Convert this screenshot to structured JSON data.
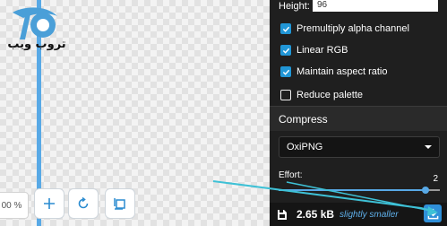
{
  "logo": {
    "text": "تروب ويب",
    "accent_color": "#4a9fd8"
  },
  "zoom": {
    "value": "00 %"
  },
  "controls": {
    "zoom_in_icon": "plus-icon",
    "rotate_icon": "rotate-icon",
    "fit_icon": "crop-icon"
  },
  "panel": {
    "height_label": "Height:",
    "height_value": "96",
    "options": [
      {
        "label": "Premultiply alpha channel",
        "checked": true
      },
      {
        "label": "Linear RGB",
        "checked": true
      },
      {
        "label": "Maintain aspect ratio",
        "checked": true
      },
      {
        "label": "Reduce palette",
        "checked": false
      }
    ],
    "compress_title": "Compress",
    "codec": "OxiPNG",
    "effort_label": "Effort:",
    "effort_value": "2",
    "effort_fraction": 0.91,
    "result_size": "2.65 kB",
    "result_note": "slightly smaller",
    "accent_color": "#2196d6"
  }
}
